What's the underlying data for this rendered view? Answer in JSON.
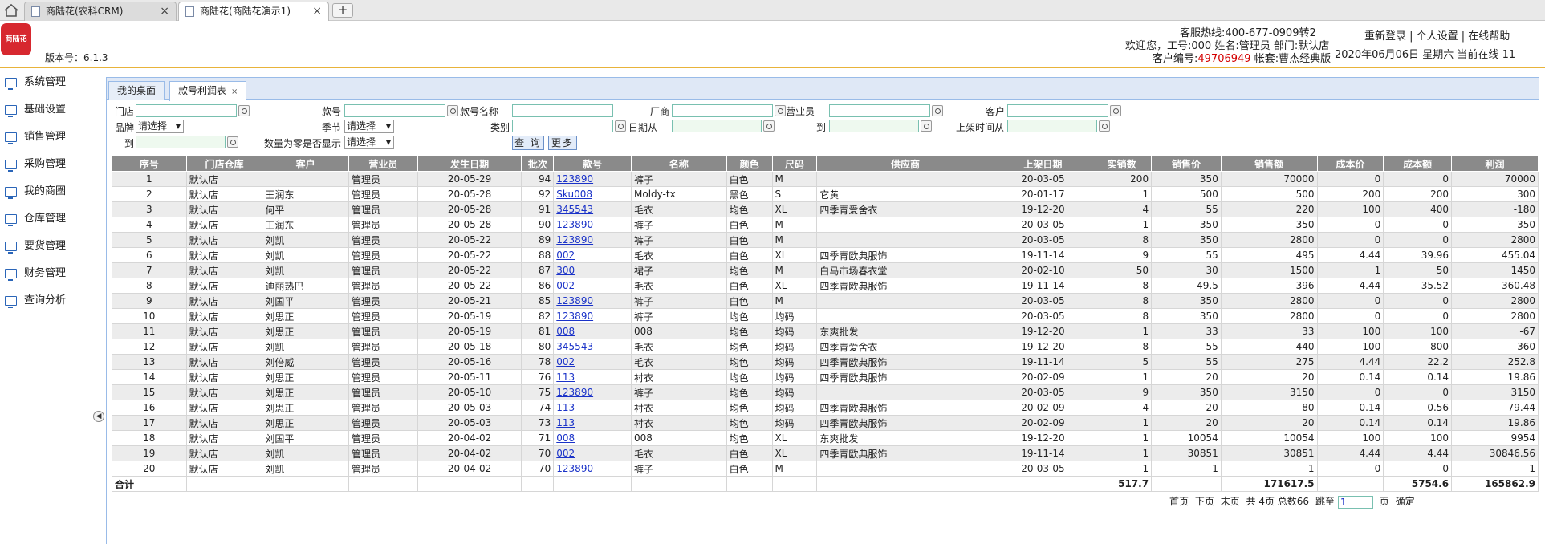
{
  "browser": {
    "tabs": [
      {
        "label": "商陆花(农科CRM)"
      },
      {
        "label": "商陆花(商陆花演示1)"
      }
    ],
    "close_glyph": "×",
    "new_tab_glyph": "+"
  },
  "header": {
    "logo_text": "商陆花",
    "version": "版本号：6.1.3",
    "hotline": "客服热线:400-677-0909转2",
    "welcome": "欢迎您，工号:000 姓名:管理员 部门:默认店",
    "customer_no_label": "客户编号:",
    "customer_no": "49706949",
    "account_set": " 帐套:曹杰经典版",
    "links": "重新登录 | 个人设置 | 在线帮助",
    "date_online": "2020年06月06日 星期六 当前在线 11"
  },
  "sidebar": {
    "items": [
      {
        "label": "系统管理"
      },
      {
        "label": "基础设置"
      },
      {
        "label": "销售管理"
      },
      {
        "label": "采购管理"
      },
      {
        "label": "我的商圈"
      },
      {
        "label": "仓库管理"
      },
      {
        "label": "要货管理"
      },
      {
        "label": "财务管理"
      },
      {
        "label": "查询分析"
      }
    ],
    "collapse_glyph": "◀"
  },
  "panel_tabs": [
    {
      "label": "我的桌面"
    },
    {
      "label": "款号利润表"
    }
  ],
  "filters": {
    "store": "门店",
    "item_no": "款号",
    "item_name": "款号名称",
    "vendor": "厂商",
    "salesperson": "营业员",
    "customer": "客户",
    "brand": "品牌",
    "brand_value": "请选择",
    "season": "季节",
    "season_value": "请选择",
    "category": "类别",
    "date_from": "日期从",
    "date_to": "到",
    "listing_from": "上架时间从",
    "listing_to": "到",
    "zero_qty": "数量为零是否显示",
    "zero_qty_value": "请选择",
    "query_button": "查 询",
    "more_button": "更多"
  },
  "table": {
    "columns": [
      "序号",
      "门店仓库",
      "客户",
      "营业员",
      "发生日期",
      "批次",
      "款号",
      "名称",
      "颜色",
      "尺码",
      "供应商",
      "上架日期",
      "实销数",
      "销售价",
      "销售额",
      "成本价",
      "成本额",
      "利润"
    ],
    "rows": [
      [
        "1",
        "默认店",
        "",
        "管理员",
        "20-05-29",
        "94",
        "123890",
        "裤子",
        "白色",
        "M",
        "",
        "20-03-05",
        "200",
        "350",
        "70000",
        "0",
        "0",
        "70000"
      ],
      [
        "2",
        "默认店",
        "王润东",
        "管理员",
        "20-05-28",
        "92",
        "Sku008",
        "Moldy-tx",
        "黑色",
        "S",
        "它黄",
        "20-01-17",
        "1",
        "500",
        "500",
        "200",
        "200",
        "300"
      ],
      [
        "3",
        "默认店",
        "何平",
        "管理员",
        "20-05-28",
        "91",
        "345543",
        "毛衣",
        "均色",
        "XL",
        "四季青爱舍衣",
        "19-12-20",
        "4",
        "55",
        "220",
        "100",
        "400",
        "-180"
      ],
      [
        "4",
        "默认店",
        "王润东",
        "管理员",
        "20-05-28",
        "90",
        "123890",
        "裤子",
        "白色",
        "M",
        "",
        "20-03-05",
        "1",
        "350",
        "350",
        "0",
        "0",
        "350"
      ],
      [
        "5",
        "默认店",
        "刘凯",
        "管理员",
        "20-05-22",
        "89",
        "123890",
        "裤子",
        "白色",
        "M",
        "",
        "20-03-05",
        "8",
        "350",
        "2800",
        "0",
        "0",
        "2800"
      ],
      [
        "6",
        "默认店",
        "刘凯",
        "管理员",
        "20-05-22",
        "88",
        "002",
        "毛衣",
        "白色",
        "XL",
        "四季青欧典服饰",
        "19-11-14",
        "9",
        "55",
        "495",
        "4.44",
        "39.96",
        "455.04"
      ],
      [
        "7",
        "默认店",
        "刘凯",
        "管理员",
        "20-05-22",
        "87",
        "300",
        "裙子",
        "均色",
        "M",
        "白马市场春衣堂",
        "20-02-10",
        "50",
        "30",
        "1500",
        "1",
        "50",
        "1450"
      ],
      [
        "8",
        "默认店",
        "迪丽热巴",
        "管理员",
        "20-05-22",
        "86",
        "002",
        "毛衣",
        "白色",
        "XL",
        "四季青欧典服饰",
        "19-11-14",
        "8",
        "49.5",
        "396",
        "4.44",
        "35.52",
        "360.48"
      ],
      [
        "9",
        "默认店",
        "刘国平",
        "管理员",
        "20-05-21",
        "85",
        "123890",
        "裤子",
        "白色",
        "M",
        "",
        "20-03-05",
        "8",
        "350",
        "2800",
        "0",
        "0",
        "2800"
      ],
      [
        "10",
        "默认店",
        "刘思正",
        "管理员",
        "20-05-19",
        "82",
        "123890",
        "裤子",
        "均色",
        "均码",
        "",
        "20-03-05",
        "8",
        "350",
        "2800",
        "0",
        "0",
        "2800"
      ],
      [
        "11",
        "默认店",
        "刘思正",
        "管理员",
        "20-05-19",
        "81",
        "008",
        "008",
        "均色",
        "均码",
        "东爽批发",
        "19-12-20",
        "1",
        "33",
        "33",
        "100",
        "100",
        "-67"
      ],
      [
        "12",
        "默认店",
        "刘凯",
        "管理员",
        "20-05-18",
        "80",
        "345543",
        "毛衣",
        "均色",
        "均码",
        "四季青爱舍衣",
        "19-12-20",
        "8",
        "55",
        "440",
        "100",
        "800",
        "-360"
      ],
      [
        "13",
        "默认店",
        "刘倍威",
        "管理员",
        "20-05-16",
        "78",
        "002",
        "毛衣",
        "均色",
        "均码",
        "四季青欧典服饰",
        "19-11-14",
        "5",
        "55",
        "275",
        "4.44",
        "22.2",
        "252.8"
      ],
      [
        "14",
        "默认店",
        "刘思正",
        "管理员",
        "20-05-11",
        "76",
        "113",
        "衬衣",
        "均色",
        "均码",
        "四季青欧典服饰",
        "20-02-09",
        "1",
        "20",
        "20",
        "0.14",
        "0.14",
        "19.86"
      ],
      [
        "15",
        "默认店",
        "刘思正",
        "管理员",
        "20-05-10",
        "75",
        "123890",
        "裤子",
        "均色",
        "均码",
        "",
        "20-03-05",
        "9",
        "350",
        "3150",
        "0",
        "0",
        "3150"
      ],
      [
        "16",
        "默认店",
        "刘思正",
        "管理员",
        "20-05-03",
        "74",
        "113",
        "衬衣",
        "均色",
        "均码",
        "四季青欧典服饰",
        "20-02-09",
        "4",
        "20",
        "80",
        "0.14",
        "0.56",
        "79.44"
      ],
      [
        "17",
        "默认店",
        "刘思正",
        "管理员",
        "20-05-03",
        "73",
        "113",
        "衬衣",
        "均色",
        "均码",
        "四季青欧典服饰",
        "20-02-09",
        "1",
        "20",
        "20",
        "0.14",
        "0.14",
        "19.86"
      ],
      [
        "18",
        "默认店",
        "刘国平",
        "管理员",
        "20-04-02",
        "71",
        "008",
        "008",
        "均色",
        "XL",
        "东爽批发",
        "19-12-20",
        "1",
        "10054",
        "10054",
        "100",
        "100",
        "9954"
      ],
      [
        "19",
        "默认店",
        "刘凯",
        "管理员",
        "20-04-02",
        "70",
        "002",
        "毛衣",
        "白色",
        "XL",
        "四季青欧典服饰",
        "19-11-14",
        "1",
        "30851",
        "30851",
        "4.44",
        "4.44",
        "30846.56"
      ],
      [
        "20",
        "默认店",
        "刘凯",
        "管理员",
        "20-04-02",
        "70",
        "123890",
        "裤子",
        "白色",
        "M",
        "",
        "20-03-05",
        "1",
        "1",
        "1",
        "0",
        "0",
        "1"
      ]
    ],
    "total": {
      "label": "合计",
      "qty": "517.7",
      "amount": "171617.5",
      "cost": "5754.6",
      "profit": "165862.9"
    }
  },
  "pager": {
    "first": "首页",
    "prev": "下页",
    "last": "末页",
    "info": "共 4页 总数66",
    "jump": "跳至",
    "page_value": "1",
    "page_unit": "页",
    "confirm": "确定"
  }
}
